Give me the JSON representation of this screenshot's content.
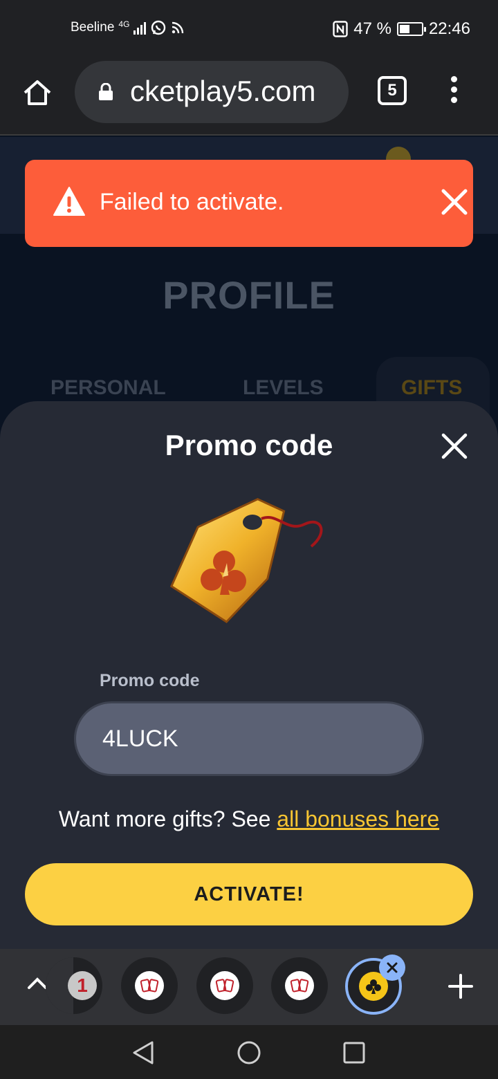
{
  "status_bar": {
    "carrier": "Beeline",
    "network": "4G",
    "battery_text": "47 %",
    "battery_level": 0.47,
    "time": "22:46"
  },
  "browser": {
    "url": "cketplay5.com",
    "tab_count": "5"
  },
  "toast": {
    "message": "Failed to activate.",
    "color": "#fd5d3a"
  },
  "page": {
    "title": "PROFILE",
    "tabs": [
      "PERSONAL",
      "LEVELS",
      "GIFTS"
    ],
    "active_tab": "GIFTS",
    "notification_count": "1"
  },
  "modal": {
    "title": "Promo code",
    "field_label": "Promo code",
    "promo_value": "4LUCK",
    "more_gifts_text": "Want more gifts? See ",
    "more_gifts_link": "all bonuses here",
    "activate_label": "ACTIVATE!",
    "accent": "#fcd043"
  },
  "tab_strip": {
    "partial_badge": "1"
  }
}
